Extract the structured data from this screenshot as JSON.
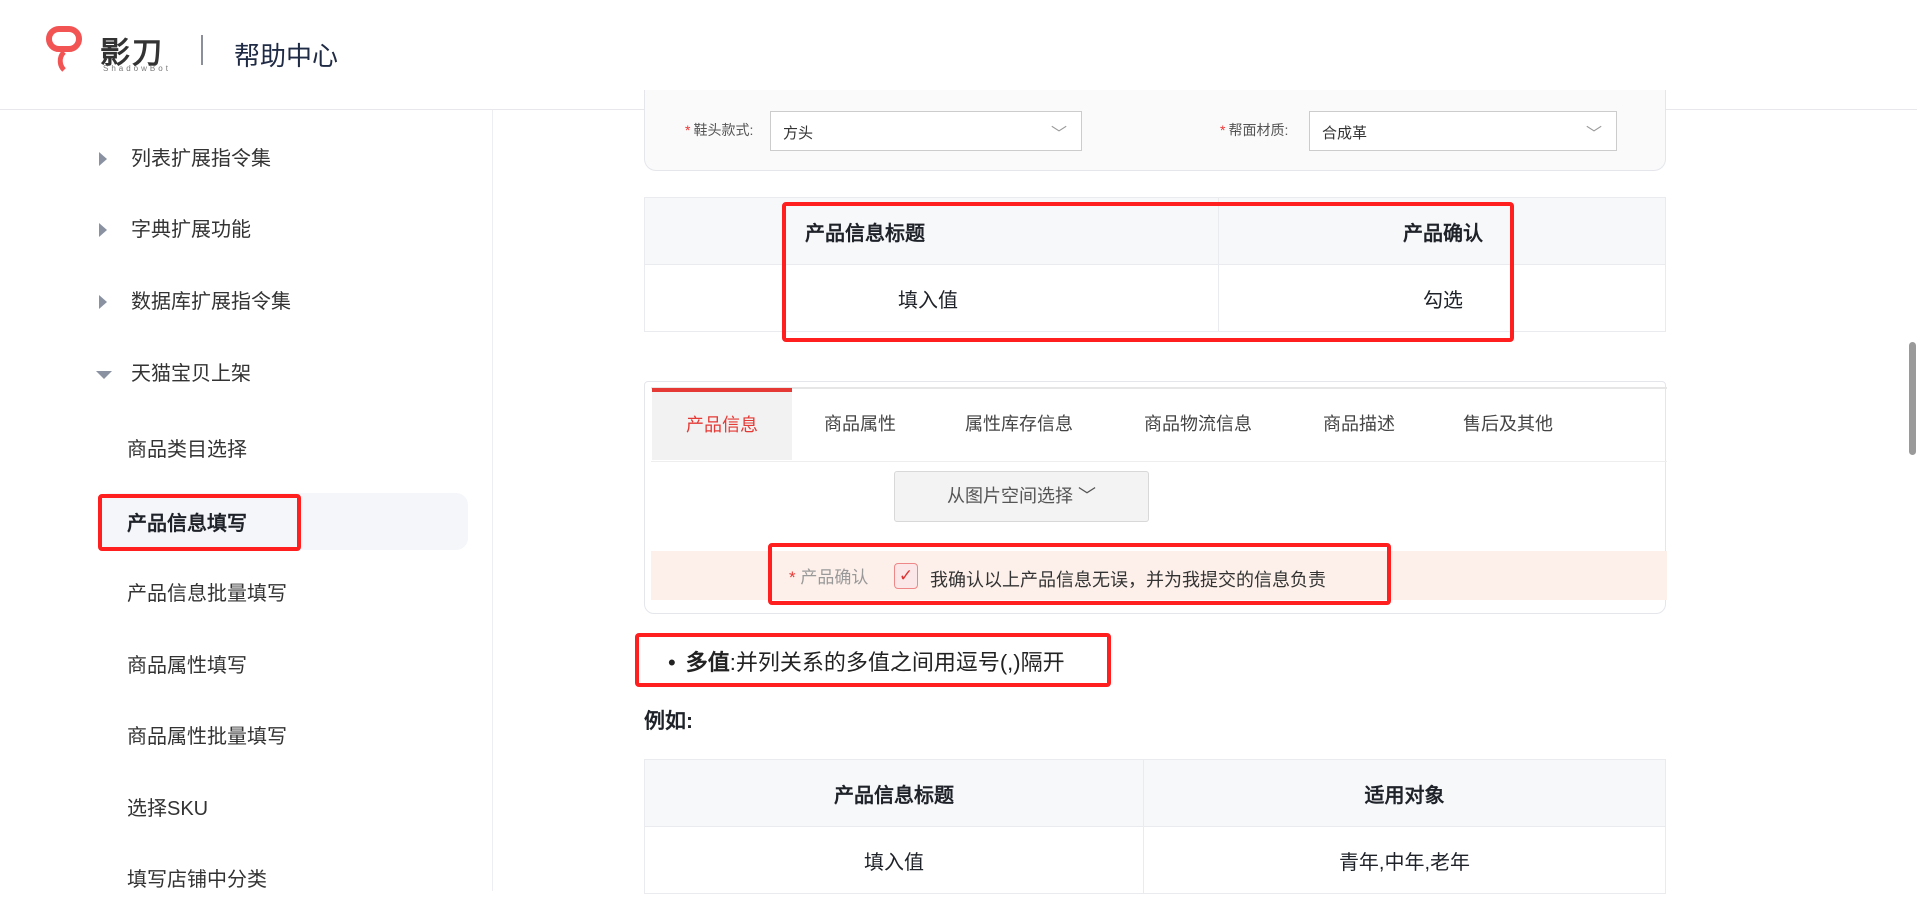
{
  "header": {
    "brand": "影刀",
    "brand_sub": "ShadowBot",
    "title": "帮助中心"
  },
  "sidebar": {
    "items": [
      {
        "label": "列表扩展指令集"
      },
      {
        "label": "字典扩展功能"
      },
      {
        "label": "数据库扩展指令集"
      },
      {
        "label": "天猫宝贝上架"
      },
      {
        "label": "商品类目选择"
      },
      {
        "label": "产品信息填写"
      },
      {
        "label": "产品信息批量填写"
      },
      {
        "label": "商品属性填写"
      },
      {
        "label": "商品属性批量填写"
      },
      {
        "label": "选择SKU"
      },
      {
        "label": "填写店铺中分类"
      }
    ]
  },
  "form": {
    "field1_label": "鞋头款式:",
    "field1_value": "方头",
    "field2_label": "帮面材质:",
    "field2_value": "合成革",
    "required": "*"
  },
  "table1": {
    "headers": [
      "产品信息标题",
      "产品确认"
    ],
    "row": [
      "填入值",
      "勾选"
    ]
  },
  "tabs": [
    "产品信息",
    "商品属性",
    "属性库存信息",
    "商品物流信息",
    "商品描述",
    "售后及其他"
  ],
  "image_select_button": "从图片空间选择",
  "confirm": {
    "label": "产品确认",
    "text": "我确认以上产品信息无误，并为我提交的信息负责"
  },
  "bullet": {
    "bold": "多值",
    "text": ":并列关系的多值之间用逗号(,)隔开"
  },
  "example_label": "例如:",
  "table2": {
    "headers": [
      "产品信息标题",
      "适用对象"
    ],
    "row": [
      "填入值",
      "青年,中年,老年"
    ]
  },
  "colors": {
    "accent": "#e53935",
    "highlight": "#ff1f1f"
  }
}
